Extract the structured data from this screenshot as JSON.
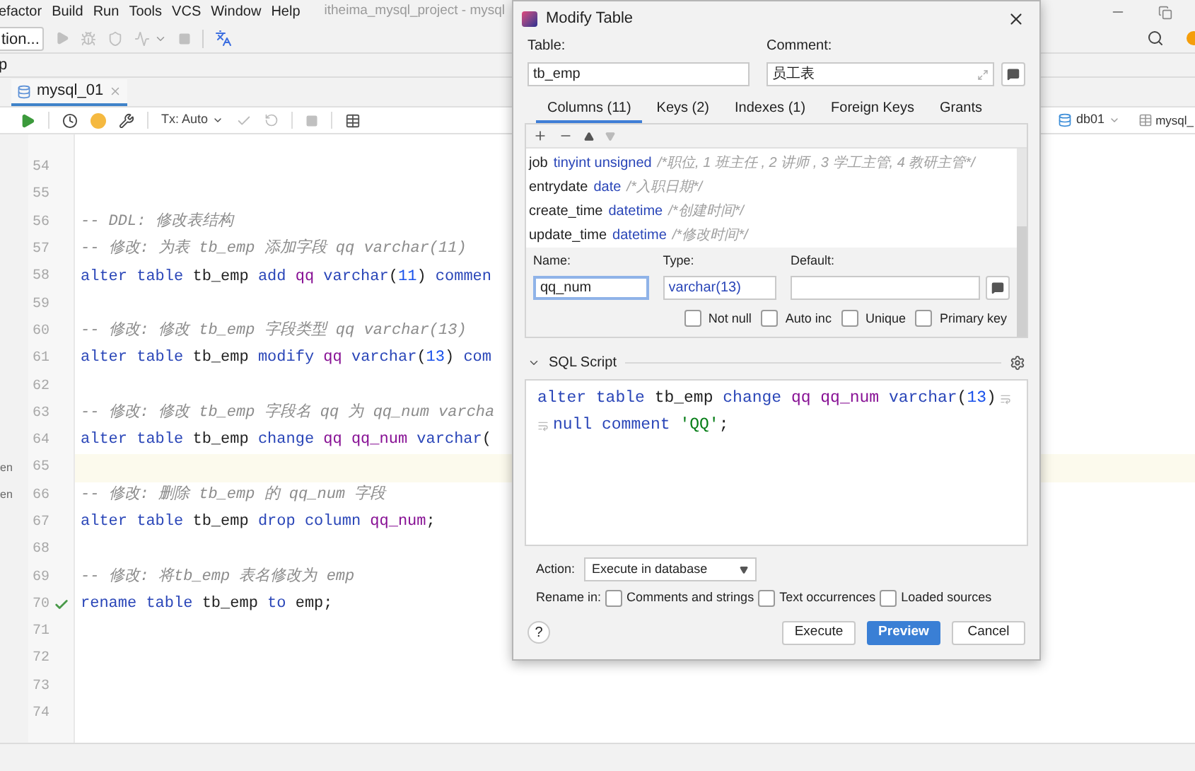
{
  "menu": [
    "efactor",
    "Build",
    "Run",
    "Tools",
    "VCS",
    "Window",
    "Help"
  ],
  "window_title": "itheima_mysql_project - mysql",
  "toolbar": {
    "config_button": "tion..."
  },
  "side_label": "p",
  "file_tab": {
    "label": "mysql_01",
    "selected": true
  },
  "editor_toolbar": {
    "tx_mode": "Tx: Auto",
    "datasource": "db01",
    "console": "mysql_"
  },
  "editor": {
    "lines": [
      {
        "number": "54"
      },
      {
        "number": "55"
      },
      {
        "number": "56",
        "tokens": [
          {
            "text": "-- DDL: 修改表结构",
            "kind": "cmt"
          }
        ]
      },
      {
        "number": "57",
        "tokens": [
          {
            "text": "-- 修改: 为表 tb_emp 添加字段 qq varchar(11)",
            "kind": "cmt"
          }
        ]
      },
      {
        "number": "58",
        "tokens": [
          {
            "text": "alter table ",
            "kind": "kw"
          },
          {
            "text": "tb_emp ",
            "kind": "id"
          },
          {
            "text": "add ",
            "kind": "kw"
          },
          {
            "text": "qq ",
            "kind": "col"
          },
          {
            "text": "varchar",
            "kind": "kw"
          },
          {
            "text": "(",
            "kind": "id"
          },
          {
            "text": "11",
            "kind": "num"
          },
          {
            "text": ") ",
            "kind": "id"
          },
          {
            "text": "commen",
            "kind": "kw"
          }
        ]
      },
      {
        "number": "59"
      },
      {
        "number": "60",
        "tokens": [
          {
            "text": "-- 修改: 修改 tb_emp 字段类型 qq varchar(13)",
            "kind": "cmt"
          }
        ]
      },
      {
        "number": "61",
        "tokens": [
          {
            "text": "alter table ",
            "kind": "kw"
          },
          {
            "text": "tb_emp ",
            "kind": "id"
          },
          {
            "text": "modify ",
            "kind": "kw"
          },
          {
            "text": "qq ",
            "kind": "col"
          },
          {
            "text": "varchar",
            "kind": "kw"
          },
          {
            "text": "(",
            "kind": "id"
          },
          {
            "text": "13",
            "kind": "num"
          },
          {
            "text": ") ",
            "kind": "id"
          },
          {
            "text": "com",
            "kind": "kw"
          }
        ]
      },
      {
        "number": "62"
      },
      {
        "number": "63",
        "tokens": [
          {
            "text": "-- 修改: 修改 tb_emp 字段名 qq 为 qq_num varcha",
            "kind": "cmt"
          }
        ]
      },
      {
        "number": "64",
        "tokens": [
          {
            "text": "alter table ",
            "kind": "kw"
          },
          {
            "text": "tb_emp ",
            "kind": "id"
          },
          {
            "text": "change ",
            "kind": "kw"
          },
          {
            "text": "qq qq_num ",
            "kind": "col"
          },
          {
            "text": "varchar",
            "kind": "kw"
          },
          {
            "text": "(",
            "kind": "id"
          }
        ]
      },
      {
        "number": "65",
        "current": true,
        "side_text": "en"
      },
      {
        "number": "66",
        "tokens": [
          {
            "text": "-- 修改: 删除 tb_emp 的 qq_num 字段",
            "kind": "cmt"
          }
        ],
        "side_text": "en"
      },
      {
        "number": "67",
        "tokens": [
          {
            "text": "alter table ",
            "kind": "kw"
          },
          {
            "text": "tb_emp ",
            "kind": "id"
          },
          {
            "text": "drop column ",
            "kind": "kw"
          },
          {
            "text": "qq_num",
            "kind": "col"
          },
          {
            "text": ";",
            "kind": "id"
          }
        ]
      },
      {
        "number": "68"
      },
      {
        "number": "69",
        "tokens": [
          {
            "text": "-- 修改: 将tb_emp 表名修改为 emp",
            "kind": "cmt"
          }
        ]
      },
      {
        "number": "70",
        "tokens": [
          {
            "text": "rename table ",
            "kind": "kw"
          },
          {
            "text": "tb_emp ",
            "kind": "id"
          },
          {
            "text": "to ",
            "kind": "kw"
          },
          {
            "text": "emp;",
            "kind": "id"
          }
        ],
        "executed": true
      },
      {
        "number": "71"
      },
      {
        "number": "72"
      },
      {
        "number": "73"
      },
      {
        "number": "74"
      }
    ]
  },
  "dialog": {
    "title": "Modify Table",
    "table_label": "Table:",
    "table_value": "tb_emp",
    "comment_label": "Comment:",
    "comment_value": "员工表",
    "tabs": [
      {
        "label": "Columns (11)",
        "selected": true
      },
      {
        "label": "Keys (2)",
        "selected": false
      },
      {
        "label": "Indexes (1)",
        "selected": false
      },
      {
        "label": "Foreign Keys",
        "selected": false
      },
      {
        "label": "Grants",
        "selected": false
      }
    ],
    "columns": [
      {
        "name": "job",
        "type": "tinyint unsigned",
        "comment": "/*职位, 1 班主任 , 2 讲师 , 3 学工主管, 4 教研主管*/"
      },
      {
        "name": "entrydate",
        "type": "date",
        "comment": "/*入职日期*/"
      },
      {
        "name": "create_time",
        "type": "datetime",
        "comment": "/*创建时间*/"
      },
      {
        "name": "update_time",
        "type": "datetime",
        "comment": "/*修改时间*/"
      }
    ],
    "column_editor": {
      "name_label": "Name:",
      "name_value": "qq_num",
      "type_label": "Type:",
      "type_value": "varchar(13)",
      "default_label": "Default:",
      "flags": [
        {
          "label": "Not null",
          "checked": false
        },
        {
          "label": "Auto inc",
          "checked": false
        },
        {
          "label": "Unique",
          "checked": false
        },
        {
          "label": "Primary key",
          "checked": false
        }
      ]
    },
    "sql_section": {
      "title": "SQL Script",
      "expanded": true,
      "lines": [
        [
          {
            "text": "alter table ",
            "kind": "kw"
          },
          {
            "text": "tb_emp ",
            "kind": "id"
          },
          {
            "text": "change ",
            "kind": "kw"
          },
          {
            "text": "qq qq_num ",
            "kind": "col"
          },
          {
            "text": "varchar",
            "kind": "kw"
          },
          {
            "text": "(",
            "kind": "id"
          },
          {
            "text": "13",
            "kind": "num"
          },
          {
            "text": ")",
            "kind": "id"
          }
        ],
        [
          {
            "text": "null comment ",
            "kind": "kw"
          },
          {
            "text": "'QQ'",
            "kind": "str"
          },
          {
            "text": ";",
            "kind": "id"
          }
        ]
      ]
    },
    "action": {
      "label": "Action:",
      "value": "Execute in database"
    },
    "rename": {
      "label": "Rename in:",
      "options": [
        {
          "label": "Comments and strings",
          "checked": false
        },
        {
          "label": "Text occurrences",
          "checked": false
        },
        {
          "label": "Loaded sources",
          "checked": false
        }
      ]
    },
    "help": "?",
    "buttons": [
      {
        "label": "Execute",
        "kind": "default"
      },
      {
        "label": "Preview",
        "kind": "primary"
      },
      {
        "label": "Cancel",
        "kind": "default"
      }
    ]
  }
}
